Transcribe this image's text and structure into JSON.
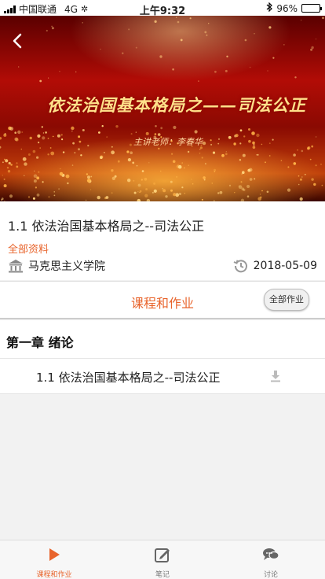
{
  "status_bar": {
    "carrier": "中国联通",
    "network": "4G",
    "time": "上午9:32",
    "battery_percent": "96%",
    "battery_level": 0.96
  },
  "banner": {
    "title": "依法治国基本格局之——司法公正",
    "subtitle": "主讲老师：李春华",
    "back_icon": "chevron-left-icon"
  },
  "course": {
    "title": "1.1 依法治国基本格局之--司法公正",
    "materials_link": "全部资料",
    "school": "马克思主义学院",
    "date": "2018-05-09"
  },
  "section": {
    "label": "课程和作业",
    "all_homework_button": "全部作业"
  },
  "chapters": [
    {
      "title": "第一章 绪论",
      "lessons": [
        {
          "title": "1.1 依法治国基本格局之--司法公正"
        }
      ]
    }
  ],
  "bottom_nav": [
    {
      "label": "课程和作业",
      "icon": "play-icon",
      "active": true
    },
    {
      "label": "笔记",
      "icon": "note-edit-icon",
      "active": false
    },
    {
      "label": "讨论",
      "icon": "chat-bubbles-icon",
      "active": false
    }
  ],
  "colors": {
    "accent": "#e8642c"
  }
}
